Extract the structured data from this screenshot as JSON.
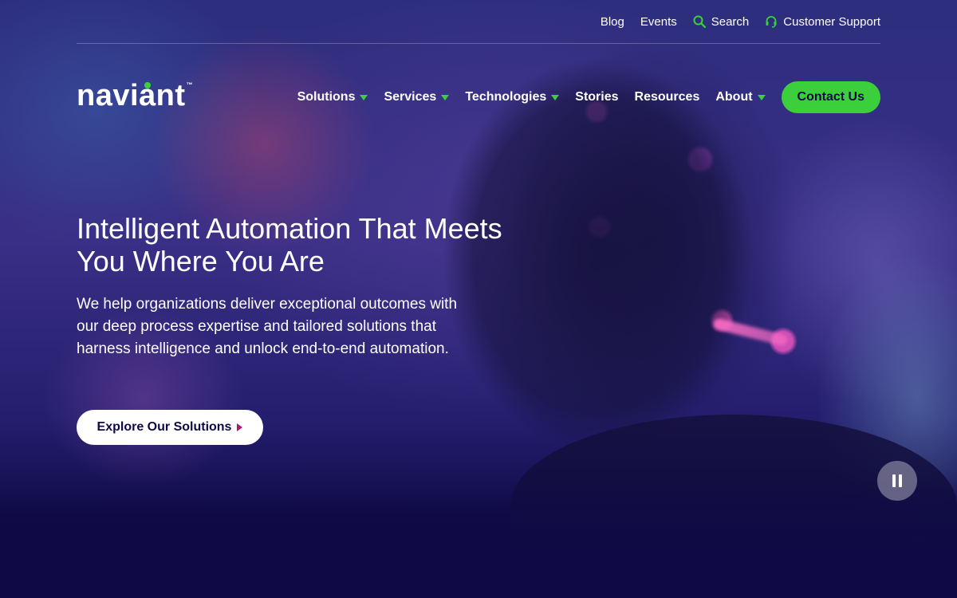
{
  "utility_nav": {
    "blog": "Blog",
    "events": "Events",
    "search": "Search",
    "support": "Customer Support",
    "search_icon": "search-icon",
    "support_icon": "headset-icon"
  },
  "brand": {
    "name": "naviant",
    "trademark": "™"
  },
  "main_nav": {
    "items": [
      {
        "label": "Solutions",
        "has_dropdown": true
      },
      {
        "label": "Services",
        "has_dropdown": true
      },
      {
        "label": "Technologies",
        "has_dropdown": true
      },
      {
        "label": "Stories",
        "has_dropdown": false
      },
      {
        "label": "Resources",
        "has_dropdown": false
      },
      {
        "label": "About",
        "has_dropdown": true
      }
    ],
    "contact_label": "Contact Us"
  },
  "hero": {
    "title": "Intelligent Automation That Meets You Where You Are",
    "description": "We help organizations deliver exceptional outcomes with our deep process expertise and tailored solutions that harness intelligence and unlock end-to-end automation.",
    "cta_label": "Explore Our Solutions",
    "pause_icon": "pause-icon"
  },
  "colors": {
    "accent_green": "#3ccf3c",
    "background_navy": "#0f0a45",
    "cta_arrow": "#b0186e"
  }
}
